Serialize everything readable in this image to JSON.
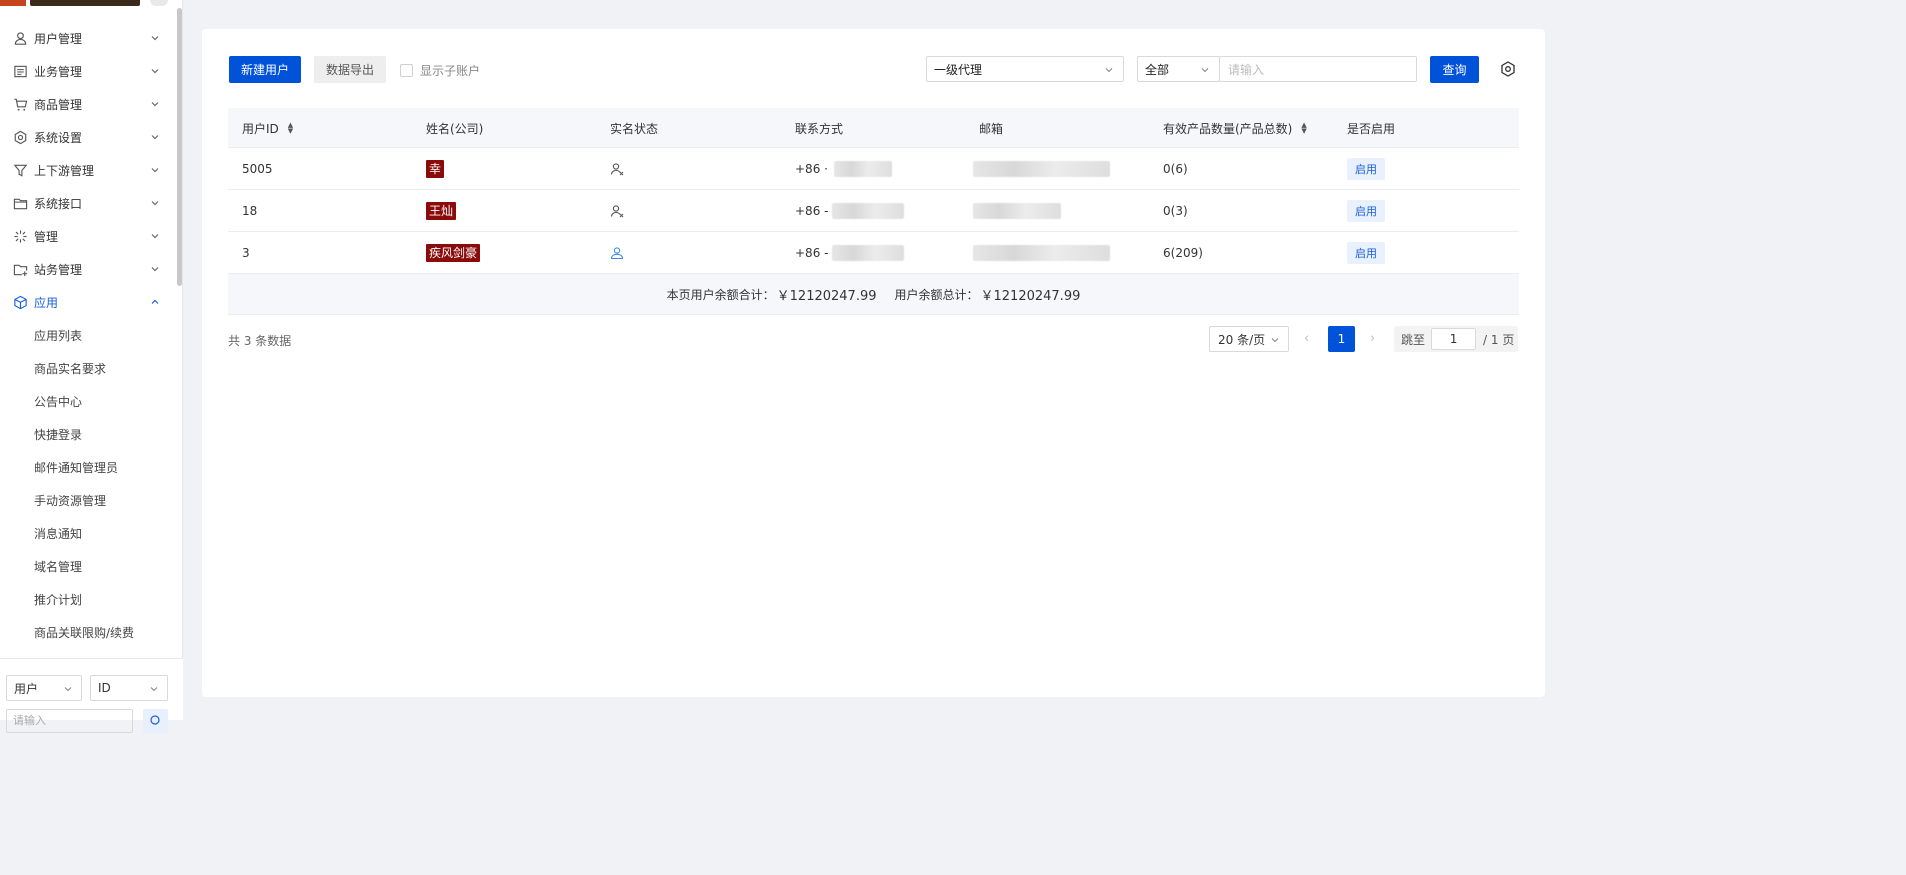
{
  "sidebar": {
    "menu": [
      {
        "label": "用户管理",
        "icon": "user-icon",
        "expanded": false
      },
      {
        "label": "业务管理",
        "icon": "document-icon",
        "expanded": false
      },
      {
        "label": "商品管理",
        "icon": "cart-icon",
        "expanded": false
      },
      {
        "label": "系统设置",
        "icon": "gear-icon",
        "expanded": false
      },
      {
        "label": "上下游管理",
        "icon": "filter-icon",
        "expanded": false
      },
      {
        "label": "系统接口",
        "icon": "folder-icon",
        "expanded": false
      },
      {
        "label": "管理",
        "icon": "sparkle-icon",
        "expanded": false
      },
      {
        "label": "站务管理",
        "icon": "folder-plus-icon",
        "expanded": false
      },
      {
        "label": "应用",
        "icon": "cube-icon",
        "expanded": true
      }
    ],
    "submenu": [
      "应用列表",
      "商品实名要求",
      "公告中心",
      "快捷登录",
      "邮件通知管理员",
      "手动资源管理",
      "消息通知",
      "域名管理",
      "推介计划",
      "商品关联限购/续费"
    ],
    "bottom": {
      "select_type": "用户",
      "select_field": "ID",
      "input_placeholder": "请输入"
    }
  },
  "toolbar": {
    "new_user": "新建用户",
    "export": "数据导出",
    "show_sub_accounts": "显示子账户",
    "agent_level": "一级代理",
    "scope": "全部",
    "search_placeholder": "请输入",
    "query": "查询"
  },
  "table": {
    "columns": [
      "用户ID",
      "姓名(公司)",
      "实名状态",
      "联系方式",
      "邮箱",
      "有效产品数量(产品总数)",
      "是否启用"
    ],
    "rows": [
      {
        "id": "5005",
        "name": "幸",
        "verified": false,
        "phone_prefix": "+86 ·",
        "products": "0(6)",
        "enabled": "启用"
      },
      {
        "id": "18",
        "name": "王灿",
        "verified": false,
        "phone_prefix": "+86 -",
        "products": "0(3)",
        "enabled": "启用"
      },
      {
        "id": "3",
        "name": "疾风剑豪",
        "verified": true,
        "phone_prefix": "+86 -",
        "products": "6(209)",
        "enabled": "启用"
      }
    ],
    "summary": {
      "page_label": "本页用户余额合计：",
      "page_amount": "￥12120247.99",
      "total_label": "用户余额总计：",
      "total_amount": "￥12120247.99"
    }
  },
  "pagination": {
    "total_text": "共 3 条数据",
    "page_size": "20 条/页",
    "current_page": "1",
    "jump_label": "跳至",
    "jump_value": "1",
    "total_pages": "/ 1 页"
  },
  "colors": {
    "primary": "#0052d9",
    "name_tag": "#8b0a0a",
    "badge_bg": "#e8f1fd"
  }
}
